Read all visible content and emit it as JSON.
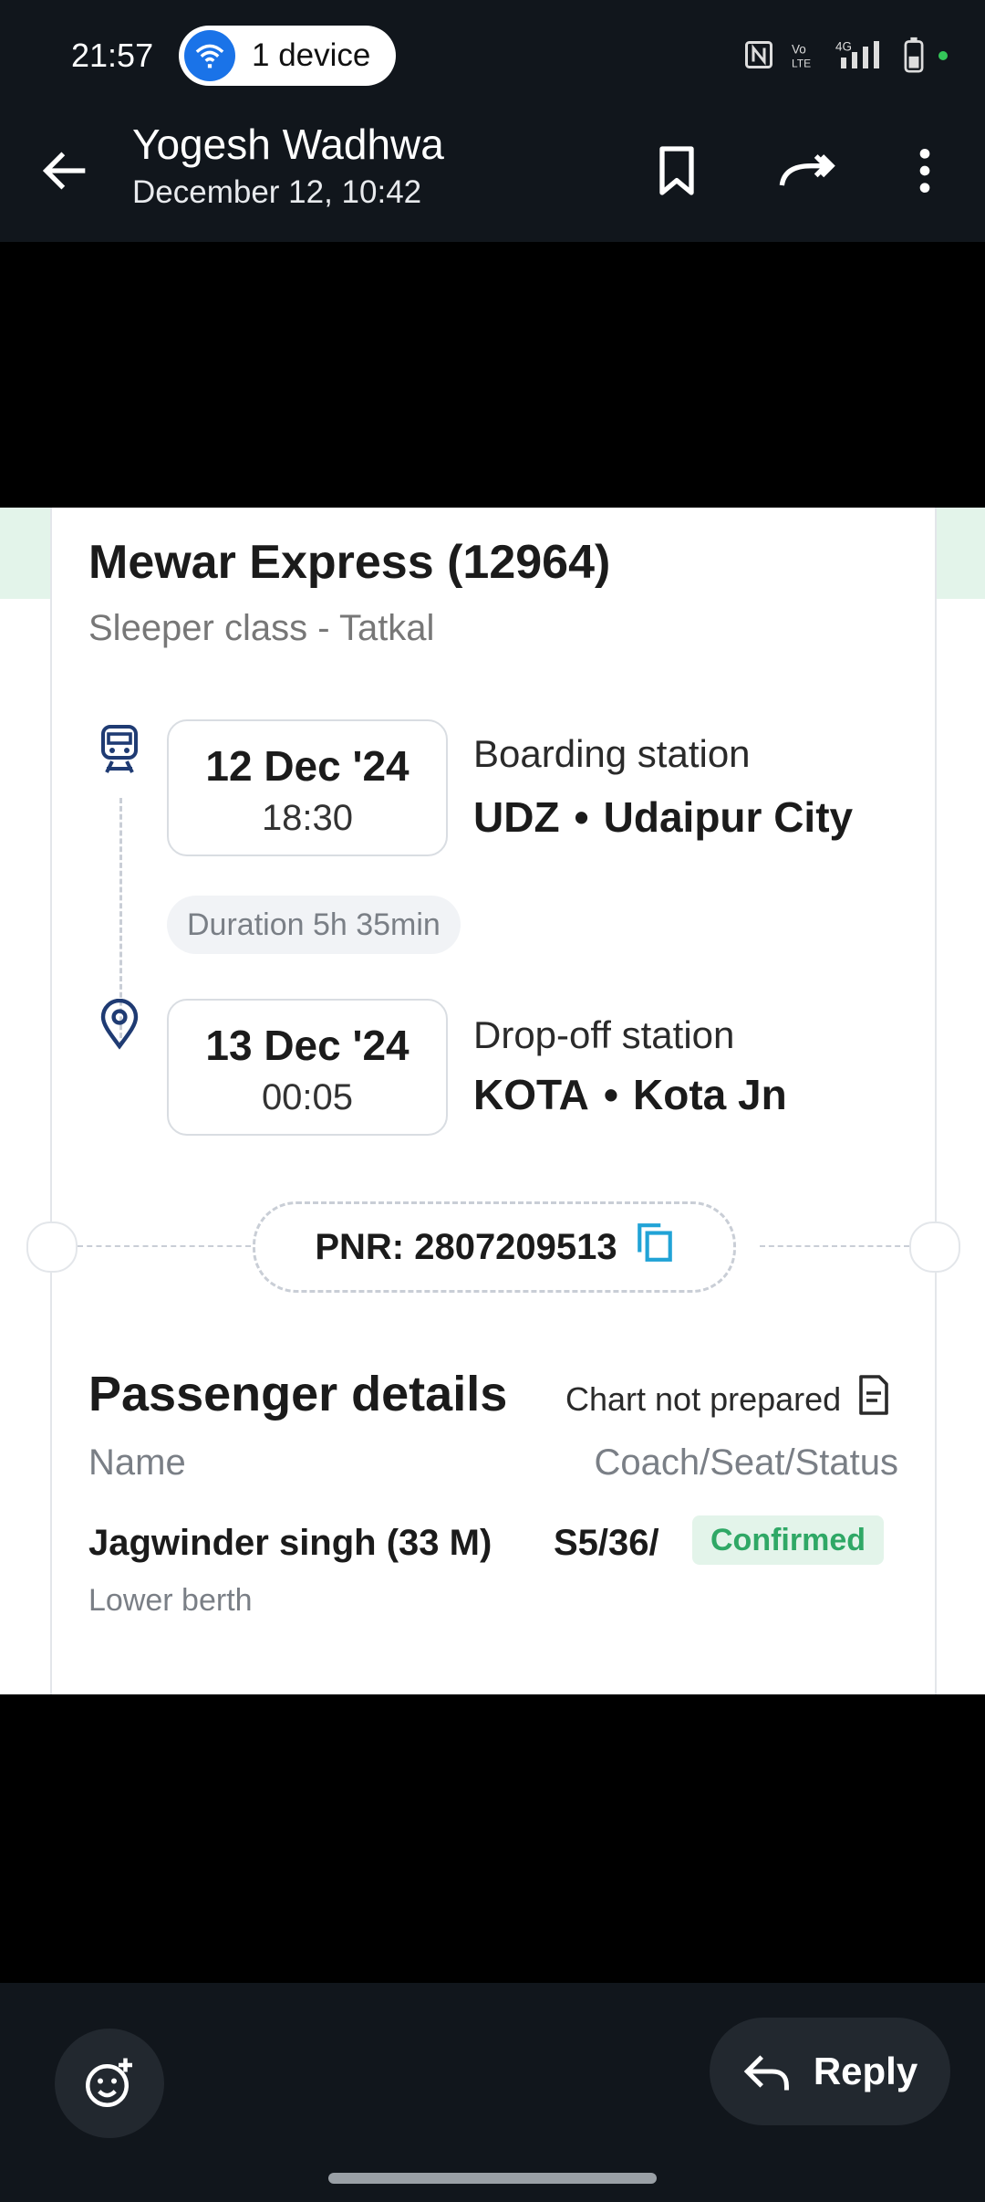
{
  "status_bar": {
    "time": "21:57",
    "device_pill": "1 device",
    "network": "4G"
  },
  "header": {
    "title": "Yogesh Wadhwa",
    "subtitle": "December 12, 10:42"
  },
  "ticket": {
    "train": "Mewar Express (12964)",
    "class_line": "Sleeper class - Tatkal",
    "boarding": {
      "date": "12 Dec '24",
      "time": "18:30",
      "label": "Boarding station",
      "code": "UDZ",
      "name": "Udaipur City"
    },
    "duration": "Duration 5h 35min",
    "dropoff": {
      "date": "13 Dec '24",
      "time": "00:05",
      "label": "Drop-off station",
      "code": "KOTA",
      "name": "Kota Jn"
    },
    "pnr": "PNR: 2807209513",
    "passenger_section": {
      "title": "Passenger details",
      "chart_status": "Chart not prepared",
      "col_name": "Name",
      "col_seat": "Coach/Seat/Status",
      "passengers": [
        {
          "name": "Jagwinder singh (33 M)",
          "seat": "S5/36/",
          "status": "Confirmed",
          "berth": "Lower berth"
        }
      ]
    }
  },
  "bottom": {
    "reply_label": "Reply"
  },
  "colors": {
    "bar_bg": "#11161c",
    "confirmed_green": "#2fa866",
    "accent_blue": "#1a73e8"
  }
}
